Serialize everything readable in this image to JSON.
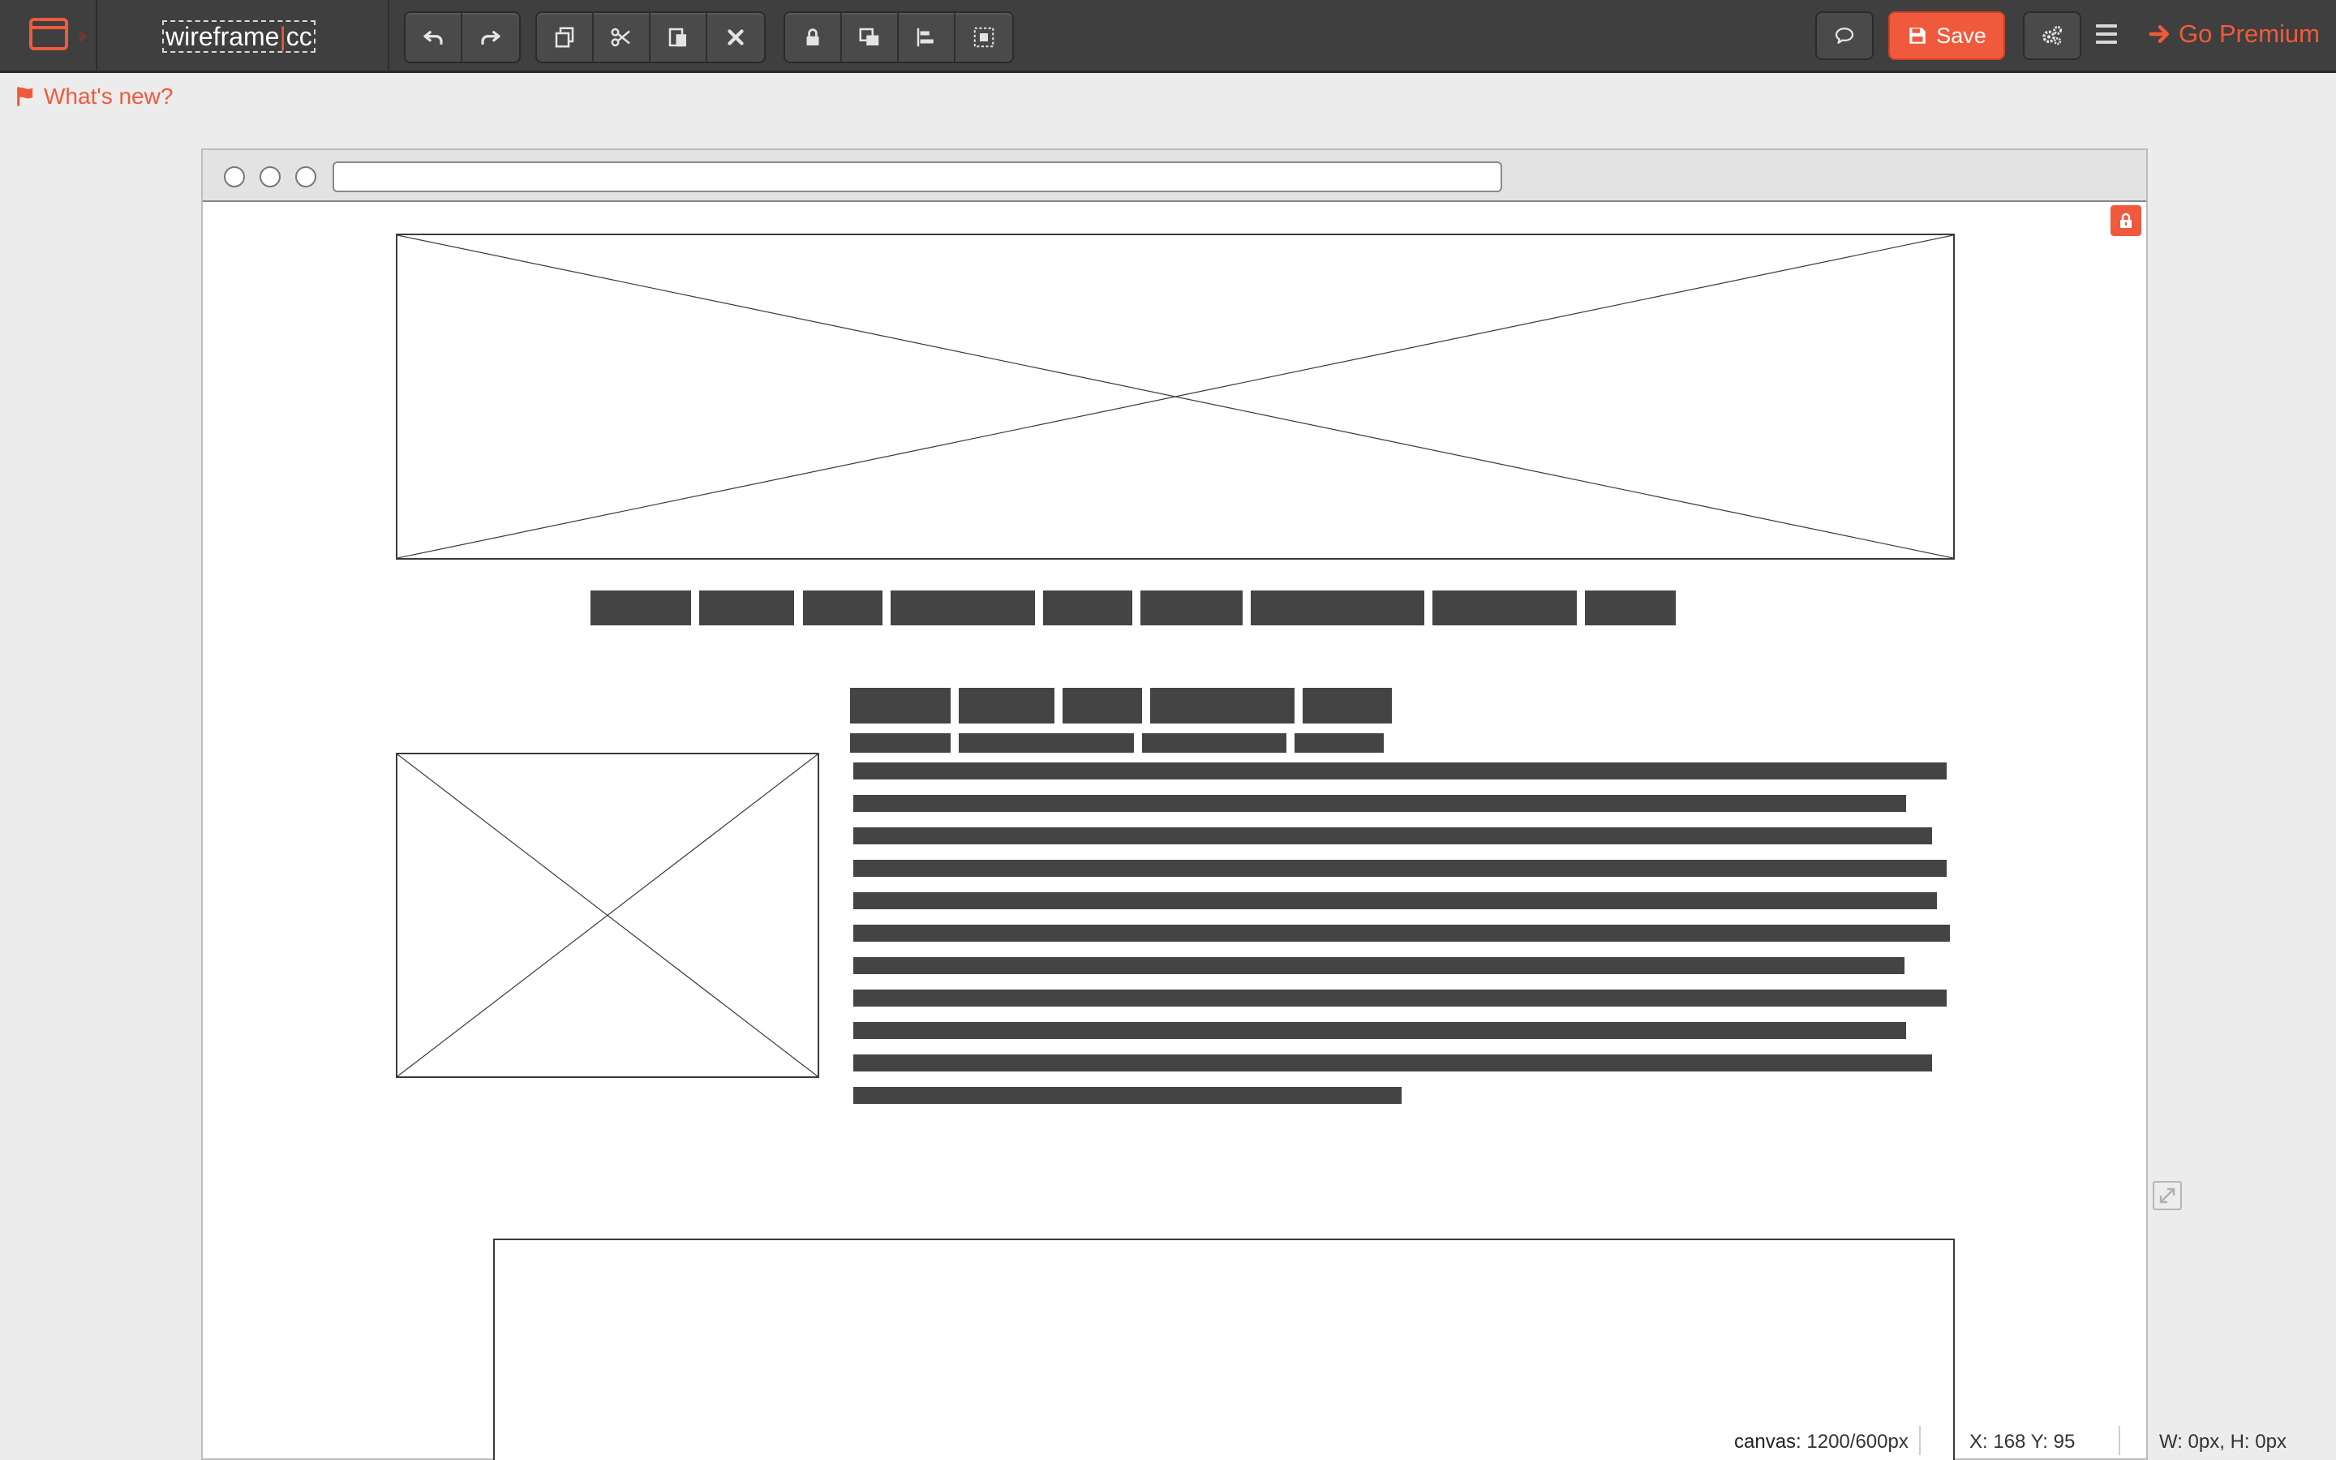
{
  "app": {
    "title_part1": "wireframe",
    "title_cursor": "|",
    "title_part2": "cc"
  },
  "toolbar": {
    "history": [
      "undo",
      "redo"
    ],
    "edit": [
      "duplicate",
      "cut",
      "paste",
      "delete"
    ],
    "arrange": [
      "lock",
      "bring-to-front",
      "align",
      "group"
    ],
    "save_label": "Save",
    "premium_label": "Go Premium"
  },
  "whats_new": "What's new?",
  "browser": {
    "url": ""
  },
  "status": {
    "canvas_label": "canvas:",
    "canvas_value": "1200/600px",
    "xy": "X: 168 Y: 95",
    "wh": "W: 0px, H: 0px"
  },
  "colors": {
    "accent": "#f05a3c",
    "toolbar_bg": "#3f3f3f",
    "page_bg": "#ececec",
    "block": "#444444"
  }
}
